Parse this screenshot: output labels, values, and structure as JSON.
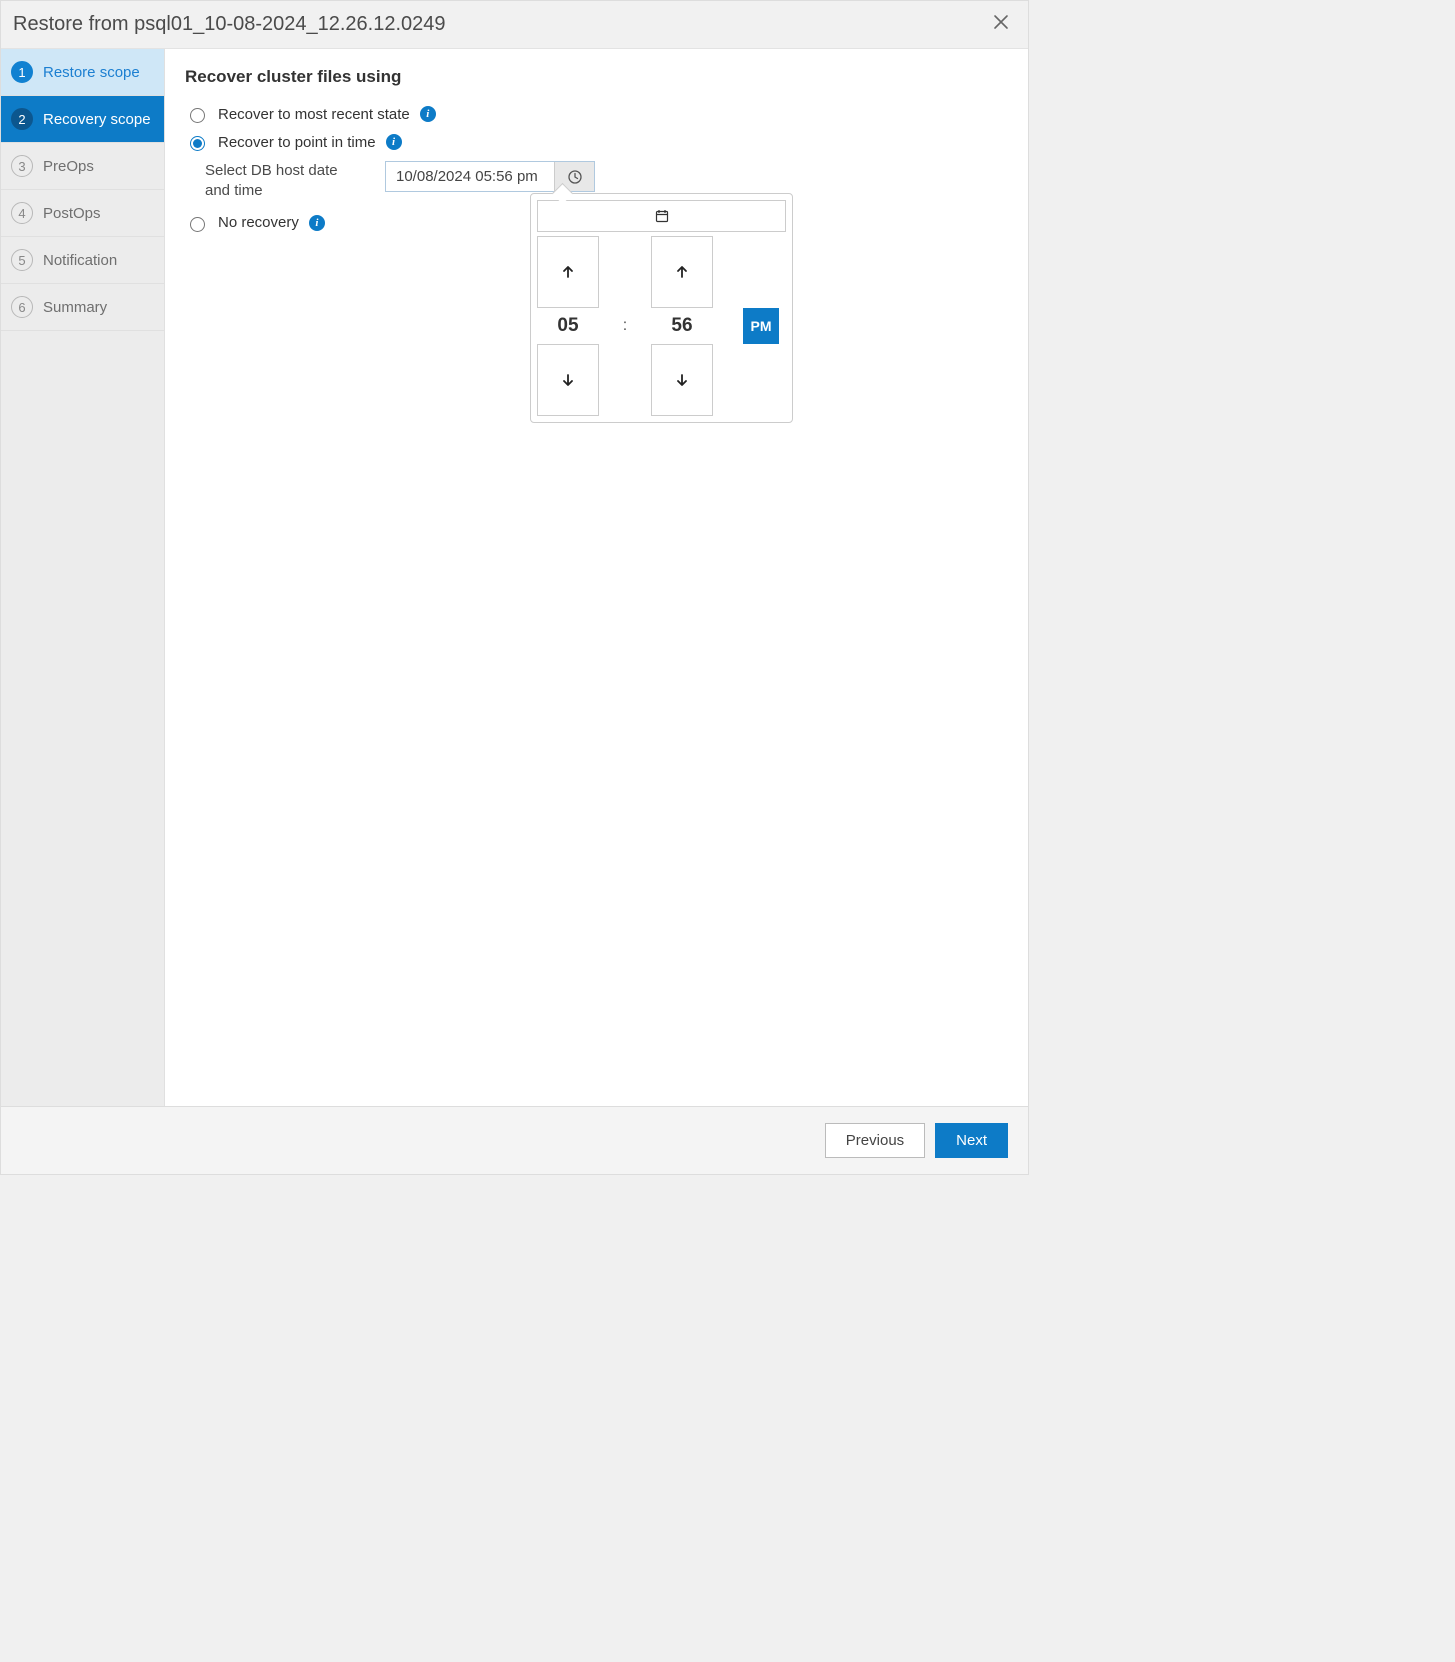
{
  "title": "Restore from psql01_10-08-2024_12.26.12.0249",
  "steps": [
    {
      "num": "1",
      "label": "Restore scope"
    },
    {
      "num": "2",
      "label": "Recovery scope"
    },
    {
      "num": "3",
      "label": "PreOps"
    },
    {
      "num": "4",
      "label": "PostOps"
    },
    {
      "num": "5",
      "label": "Notification"
    },
    {
      "num": "6",
      "label": "Summary"
    }
  ],
  "content": {
    "heading": "Recover cluster files using",
    "opt_recent": "Recover to most recent state",
    "opt_point": "Recover to point in time",
    "opt_none": "No recovery",
    "sublabel": "Select DB host date and time",
    "datetime_value": "10/08/2024 05:56 pm"
  },
  "time_picker": {
    "hour": "05",
    "minute": "56",
    "colon": ":",
    "ampm": "PM"
  },
  "footer": {
    "previous": "Previous",
    "next": "Next"
  }
}
